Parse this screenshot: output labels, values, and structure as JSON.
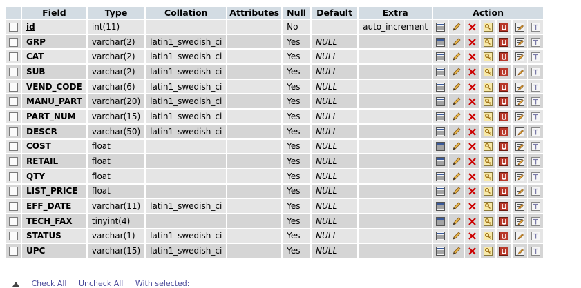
{
  "headers": {
    "field": "Field",
    "type": "Type",
    "collation": "Collation",
    "attributes": "Attributes",
    "null": "Null",
    "default": "Default",
    "extra": "Extra",
    "action": "Action"
  },
  "rows": [
    {
      "field": "id",
      "type": "int(11)",
      "collation": "",
      "attributes": "",
      "null": "No",
      "default": "",
      "extra": "auto_increment",
      "primary": true
    },
    {
      "field": "GRP",
      "type": "varchar(2)",
      "collation": "latin1_swedish_ci",
      "attributes": "",
      "null": "Yes",
      "default": "NULL",
      "extra": ""
    },
    {
      "field": "CAT",
      "type": "varchar(2)",
      "collation": "latin1_swedish_ci",
      "attributes": "",
      "null": "Yes",
      "default": "NULL",
      "extra": ""
    },
    {
      "field": "SUB",
      "type": "varchar(2)",
      "collation": "latin1_swedish_ci",
      "attributes": "",
      "null": "Yes",
      "default": "NULL",
      "extra": ""
    },
    {
      "field": "VEND_CODE",
      "type": "varchar(6)",
      "collation": "latin1_swedish_ci",
      "attributes": "",
      "null": "Yes",
      "default": "NULL",
      "extra": ""
    },
    {
      "field": "MANU_PART",
      "type": "varchar(20)",
      "collation": "latin1_swedish_ci",
      "attributes": "",
      "null": "Yes",
      "default": "NULL",
      "extra": ""
    },
    {
      "field": "PART_NUM",
      "type": "varchar(15)",
      "collation": "latin1_swedish_ci",
      "attributes": "",
      "null": "Yes",
      "default": "NULL",
      "extra": ""
    },
    {
      "field": "DESCR",
      "type": "varchar(50)",
      "collation": "latin1_swedish_ci",
      "attributes": "",
      "null": "Yes",
      "default": "NULL",
      "extra": ""
    },
    {
      "field": "COST",
      "type": "float",
      "collation": "",
      "attributes": "",
      "null": "Yes",
      "default": "NULL",
      "extra": ""
    },
    {
      "field": "RETAIL",
      "type": "float",
      "collation": "",
      "attributes": "",
      "null": "Yes",
      "default": "NULL",
      "extra": ""
    },
    {
      "field": "QTY",
      "type": "float",
      "collation": "",
      "attributes": "",
      "null": "Yes",
      "default": "NULL",
      "extra": ""
    },
    {
      "field": "LIST_PRICE",
      "type": "float",
      "collation": "",
      "attributes": "",
      "null": "Yes",
      "default": "NULL",
      "extra": ""
    },
    {
      "field": "EFF_DATE",
      "type": "varchar(11)",
      "collation": "latin1_swedish_ci",
      "attributes": "",
      "null": "Yes",
      "default": "NULL",
      "extra": ""
    },
    {
      "field": "TECH_FAX",
      "type": "tinyint(4)",
      "collation": "",
      "attributes": "",
      "null": "Yes",
      "default": "NULL",
      "extra": ""
    },
    {
      "field": "STATUS",
      "type": "varchar(1)",
      "collation": "latin1_swedish_ci",
      "attributes": "",
      "null": "Yes",
      "default": "NULL",
      "extra": ""
    },
    {
      "field": "UPC",
      "type": "varchar(15)",
      "collation": "latin1_swedish_ci",
      "attributes": "",
      "null": "Yes",
      "default": "NULL",
      "extra": ""
    }
  ],
  "actions": [
    {
      "name": "browse-distinct-icon"
    },
    {
      "name": "edit-icon"
    },
    {
      "name": "drop-icon"
    },
    {
      "name": "primary-key-icon"
    },
    {
      "name": "unique-icon"
    },
    {
      "name": "index-icon"
    },
    {
      "name": "fulltext-icon"
    }
  ],
  "footer": {
    "check_all": "Check All",
    "uncheck_all": "Uncheck All",
    "with_selected": "With selected:"
  },
  "colors": {
    "header_bg": "#d3dce3",
    "row_odd": "#e5e5e5",
    "row_even": "#d5d5d5",
    "drop_red": "#cc0000"
  }
}
